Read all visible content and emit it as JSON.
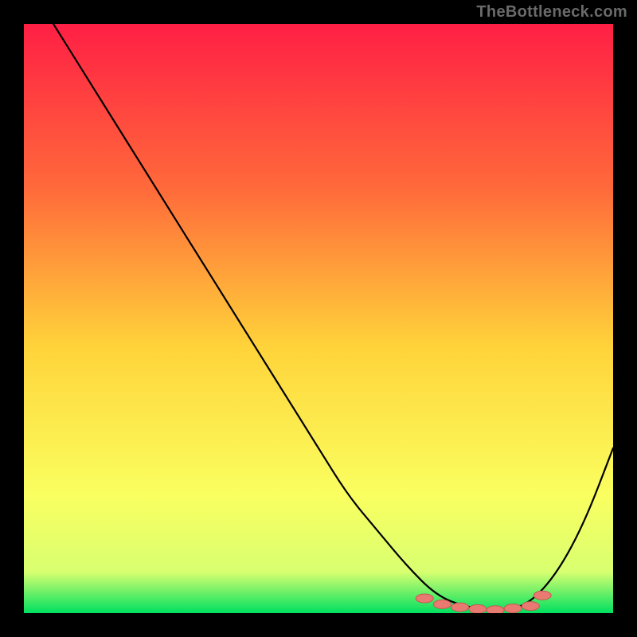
{
  "watermark": "TheBottleneck.com",
  "colors": {
    "background": "#000000",
    "watermark_text": "#6a6a6a",
    "gradient_top": "#ff1f45",
    "gradient_upper_mid": "#ff6a3a",
    "gradient_mid": "#ffd43a",
    "gradient_lower_mid": "#faff60",
    "gradient_near_bottom": "#d8ff70",
    "gradient_bottom": "#00e060",
    "curve": "#000000",
    "marker_fill": "#e97a72",
    "marker_stroke": "#c55a52"
  },
  "chart_data": {
    "type": "line",
    "title": "",
    "xlabel": "",
    "ylabel": "",
    "xlim": [
      0,
      100
    ],
    "ylim": [
      0,
      100
    ],
    "grid": false,
    "legend": false,
    "series": [
      {
        "name": "bottleneck-curve",
        "x": [
          5,
          10,
          15,
          20,
          25,
          30,
          35,
          40,
          45,
          50,
          55,
          60,
          65,
          70,
          75,
          80,
          85,
          90,
          95,
          100
        ],
        "y": [
          100,
          92,
          84,
          76,
          68,
          60,
          52,
          44,
          36,
          28,
          20,
          14,
          8,
          3,
          1,
          0.5,
          1,
          6,
          15,
          28
        ]
      }
    ],
    "markers": {
      "name": "highlighted-region",
      "x": [
        68,
        71,
        74,
        77,
        80,
        83,
        86,
        88
      ],
      "y": [
        2.5,
        1.5,
        1,
        0.7,
        0.5,
        0.8,
        1.2,
        3
      ]
    }
  }
}
